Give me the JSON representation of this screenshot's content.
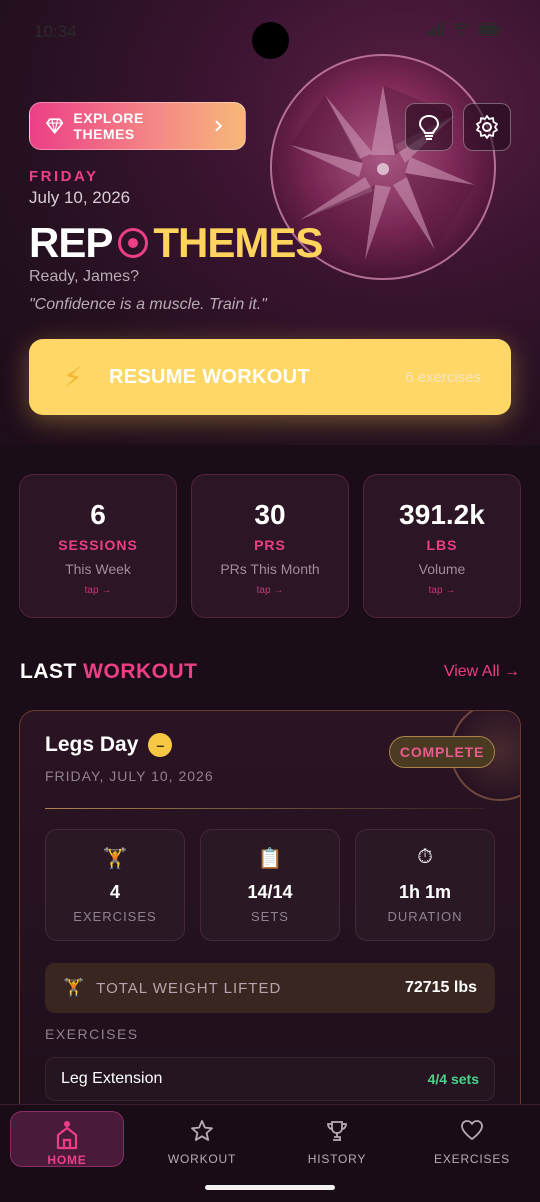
{
  "status_bar": {
    "time": "10:34"
  },
  "header": {
    "explore_label": "EXPLORE THEMES",
    "day": "FRIDAY",
    "date": "July 10, 2026",
    "brand_left": "REP",
    "brand_right": "THEMES",
    "greeting": "Ready, James?",
    "quote": "\"Confidence is a muscle. Train it.\""
  },
  "resume": {
    "label": "RESUME WORKOUT",
    "meta": "6 exercises"
  },
  "stats": [
    {
      "value": "6",
      "unit": "SESSIONS",
      "desc": "This Week",
      "tap": "tap →"
    },
    {
      "value": "30",
      "unit": "PRS",
      "desc": "PRs This Month",
      "tap": "tap →"
    },
    {
      "value": "391.2k",
      "unit": "LBS",
      "desc": "Volume",
      "tap": "tap →"
    }
  ],
  "last_workout": {
    "title_a": "LAST",
    "title_b": "WORKOUT",
    "view_all": "View All →",
    "name": "Legs Day",
    "date": "FRIDAY, JULY 10, 2026",
    "badge": "COMPLETE",
    "metrics": [
      {
        "icon": "dumbbell-icon",
        "value": "4",
        "label": "EXERCISES"
      },
      {
        "icon": "clipboard-icon",
        "value": "14/14",
        "label": "SETS"
      },
      {
        "icon": "stopwatch-icon",
        "value": "1h 1m",
        "label": "DURATION"
      }
    ],
    "total_label": "TOTAL WEIGHT LIFTED",
    "total_value": "72715 lbs",
    "exercises_header": "EXERCISES",
    "exercises": [
      {
        "name": "Leg Extension",
        "sets": "4/4 sets"
      }
    ]
  },
  "nav": [
    {
      "label": "HOME",
      "icon": "home-icon",
      "active": true
    },
    {
      "label": "WORKOUT",
      "icon": "star-icon",
      "active": false
    },
    {
      "label": "HISTORY",
      "icon": "trophy-icon",
      "active": false
    },
    {
      "label": "EXERCISES",
      "icon": "heart-icon",
      "active": false
    }
  ],
  "colors": {
    "accent": "#ec3f86",
    "gold": "#ffd766",
    "success": "#4cd18c",
    "background": "#1a0d17"
  }
}
